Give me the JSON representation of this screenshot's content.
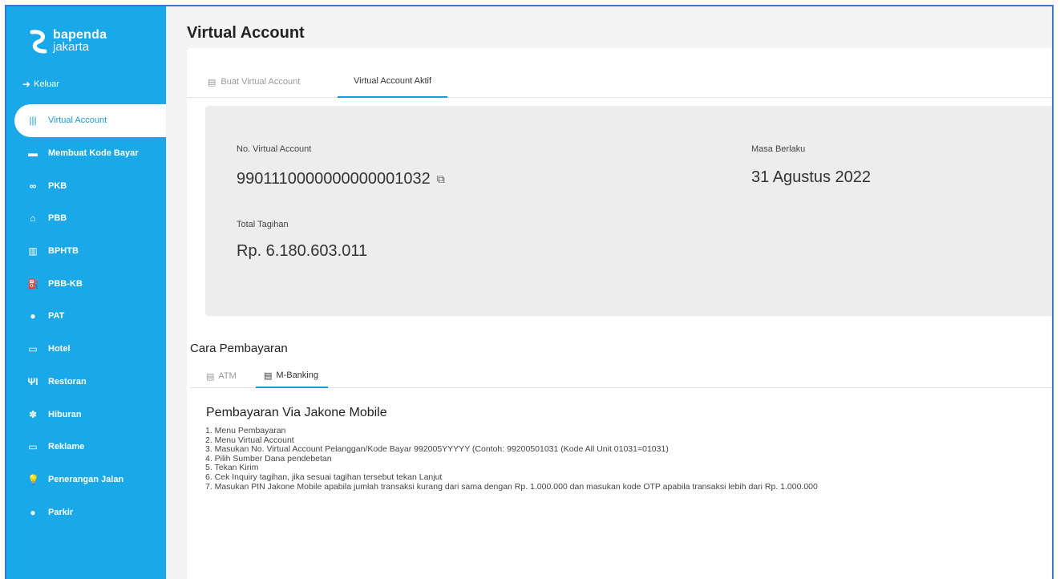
{
  "brand": {
    "name_line1": "bapenda",
    "name_line2": "jakarta"
  },
  "logout": {
    "label": "Keluar",
    "icon": "sign-out-icon"
  },
  "sidebar": {
    "items": [
      {
        "label": "Virtual Account",
        "icon": "barcode-icon",
        "glyph": "|||",
        "active": true
      },
      {
        "label": "Membuat Kode Bayar",
        "icon": "money-icon",
        "glyph": "▬"
      },
      {
        "label": "PKB",
        "icon": "motorcycle-icon",
        "glyph": "∞"
      },
      {
        "label": "PBB",
        "icon": "home-icon",
        "glyph": "⌂"
      },
      {
        "label": "BPHTB",
        "icon": "building-icon",
        "glyph": "▥"
      },
      {
        "label": "PBB-KB",
        "icon": "gas-pump-icon",
        "glyph": "⛽"
      },
      {
        "label": "PAT",
        "icon": "water-drop-icon",
        "glyph": "●"
      },
      {
        "label": "Hotel",
        "icon": "bed-icon",
        "glyph": "▭"
      },
      {
        "label": "Restoran",
        "icon": "cutlery-icon",
        "glyph": "ΨI"
      },
      {
        "label": "Hiburan",
        "icon": "film-reel-icon",
        "glyph": "✽"
      },
      {
        "label": "Reklame",
        "icon": "billboard-icon",
        "glyph": "▭"
      },
      {
        "label": "Penerangan Jalan",
        "icon": "lightbulb-icon",
        "glyph": "💡"
      },
      {
        "label": "Parkir",
        "icon": "parking-icon",
        "glyph": "●"
      }
    ]
  },
  "header": {
    "title": "Virtual Account"
  },
  "tabs": [
    {
      "label": "Buat Virtual Account",
      "icon": "list-icon"
    },
    {
      "label": "Virtual Account Aktif",
      "icon": "",
      "active": true
    }
  ],
  "account": {
    "va_label": "No. Virtual Account",
    "va_number": "9901110000000000001032",
    "expiry_label": "Masa Berlaku",
    "expiry_value": "31 Agustus 2022",
    "total_label": "Total Tagihan",
    "total_value": "Rp. 6.180.603.011"
  },
  "payment": {
    "title": "Cara Pembayaran",
    "tabs": [
      {
        "label": "ATM",
        "icon": "list-icon"
      },
      {
        "label": "M-Banking",
        "icon": "list-icon",
        "active": true
      }
    ],
    "section_title": "Pembayaran Via Jakone Mobile",
    "steps": [
      "1. Menu Pembayaran",
      "2. Menu Virtual Account",
      "3. Masukan No. Virtual Account Pelanggan/Kode Bayar 992005YYYYY (Contoh: 99200501031 (Kode All Unit 01031=01031)",
      "4. Pilih Sumber Dana pendebetan",
      "5. Tekan Kirim",
      "6. Cek Inquiry tagihan, jika sesuai tagihan tersebut tekan Lanjut",
      "7. Masukan PIN Jakone Mobile apabila jumlah transaksi kurang dari sama dengan Rp. 1.000.000 dan masukan kode OTP apabila transaksi lebih dari Rp. 1.000.000"
    ]
  },
  "colors": {
    "sidebar": "#1aa9e8",
    "accent": "#1a9bd8",
    "panel": "#ededed"
  }
}
